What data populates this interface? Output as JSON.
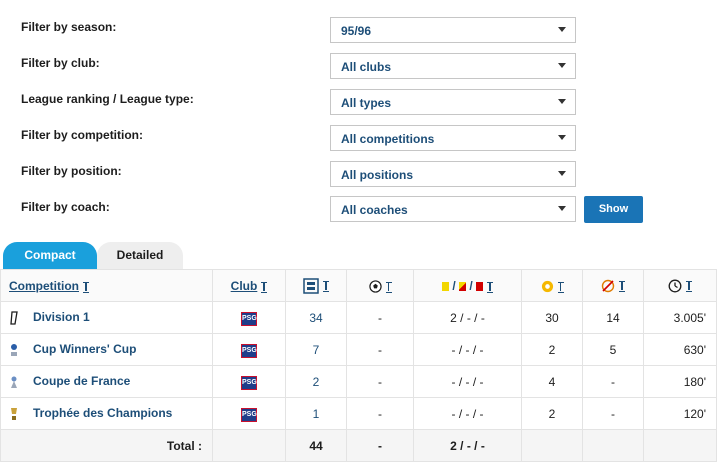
{
  "filters": [
    {
      "label": "Filter by season:",
      "value": "95/96"
    },
    {
      "label": "Filter by club:",
      "value": "All clubs"
    },
    {
      "label": "League ranking / League type:",
      "value": "All types"
    },
    {
      "label": "Filter by competition:",
      "value": "All competitions"
    },
    {
      "label": "Filter by position:",
      "value": "All positions"
    },
    {
      "label": "Filter by coach:",
      "value": "All coaches"
    }
  ],
  "show_button": "Show",
  "tabs": {
    "compact": "Compact",
    "detailed": "Detailed"
  },
  "table": {
    "headers": {
      "competition": "Competition",
      "club": "Club",
      "appearances_icon": "squad-icon",
      "goals_icon": "football-icon",
      "cards_icon": "cards-icon",
      "assists_icon": "assist-icon",
      "subbed_off_icon": "substitution-icon",
      "minutes_icon": "clock-icon"
    },
    "rows": [
      {
        "competition": "Division 1",
        "club_logo": "PSG",
        "apps": "34",
        "goals": "-",
        "cards": "2 / - / -",
        "c4": "30",
        "c5": "14",
        "minutes": "3.005'"
      },
      {
        "competition": "Cup Winners' Cup",
        "club_logo": "PSG",
        "apps": "7",
        "goals": "-",
        "cards": "- / - / -",
        "c4": "2",
        "c5": "5",
        "minutes": "630'"
      },
      {
        "competition": "Coupe de France",
        "club_logo": "PSG",
        "apps": "2",
        "goals": "-",
        "cards": "- / - / -",
        "c4": "4",
        "c5": "-",
        "minutes": "180'"
      },
      {
        "competition": "Trophée des Champions",
        "club_logo": "PSG",
        "apps": "1",
        "goals": "-",
        "cards": "- / - / -",
        "c4": "2",
        "c5": "-",
        "minutes": "120'"
      }
    ],
    "total": {
      "label": "Total :",
      "apps": "44",
      "goals": "-",
      "cards": "2 / - / -",
      "c4": "",
      "c5": "",
      "minutes": ""
    }
  },
  "colors": {
    "link": "#1d4e78",
    "tab_active": "#1aa0dc",
    "button": "#1a74b6"
  }
}
